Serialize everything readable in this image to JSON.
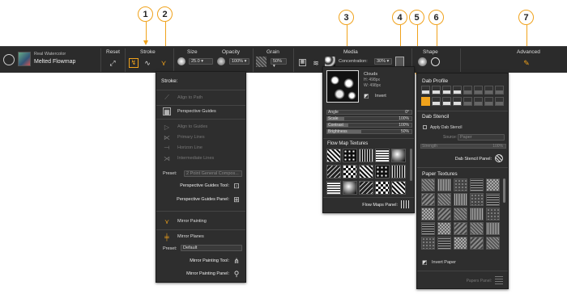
{
  "callouts": [
    "1",
    "2",
    "3",
    "4",
    "5",
    "6",
    "7"
  ],
  "brush": {
    "category": "Real Watercolor",
    "variant": "Melted Flowmap"
  },
  "toolbar": {
    "reset": "Reset",
    "stroke": "Stroke",
    "size": "Size",
    "size_value": "25.0",
    "opacity": "Opacity",
    "opacity_value": "100%",
    "grain": "Grain",
    "grain_value": "50%",
    "media": "Media",
    "concentration_label": "Concentration:",
    "concentration_value": "30%",
    "shape": "Shape",
    "advanced": "Advanced"
  },
  "stroke_panel": {
    "title": "Stroke:",
    "align_to_path": "Align to Path",
    "perspective_guides": "Perspective Guides",
    "align_to_guides": "Align to Guides",
    "primary_lines": "Primary Lines",
    "horizon_line": "Horizon Line",
    "intermediate_lines": "Intermediate Lines",
    "preset_label": "Preset:",
    "preset_value": "2 Point General Compos...",
    "persp_tool": "Perspective Guides Tool:",
    "persp_panel": "Perspective Guides Panel:",
    "mirror_painting": "Mirror Painting",
    "mirror_planes": "Mirror Planes",
    "mirror_preset_label": "Preset:",
    "mirror_preset_value": "Default",
    "mirror_tool": "Mirror Painting Tool:",
    "mirror_panel": "Mirror Painting Panel:"
  },
  "media_panel": {
    "texture_name": "Clouds",
    "height": "H: 498px",
    "width": "W: 498px",
    "invert": "Invert",
    "angle_label": "Angle",
    "angle_value": "0°",
    "scale_label": "Scale",
    "scale_value": "100%",
    "contrast_label": "Contrast",
    "contrast_value": "100%",
    "brightness_label": "Brightness",
    "brightness_value": "50%",
    "library_title": "Flow Map Textures",
    "panel_label": "Flow Maps Panel:"
  },
  "shape_panel": {
    "dab_profile": "Dab Profile",
    "dab_stencil": "Dab Stencil",
    "apply_stencil": "Apply Dab Stencil",
    "source_label": "Source:",
    "source_value": "Paper",
    "strength_label": "Strength",
    "strength_value": "100%",
    "stencil_panel": "Dab Stencil Panel:",
    "paper_textures": "Paper Textures",
    "invert_paper": "Invert Paper",
    "papers_panel": "Papers Panel:"
  },
  "colors": {
    "accent": "#f0a21b",
    "toolbar_bg": "#2b2b2b",
    "panel_bg": "#2e2e2e"
  }
}
